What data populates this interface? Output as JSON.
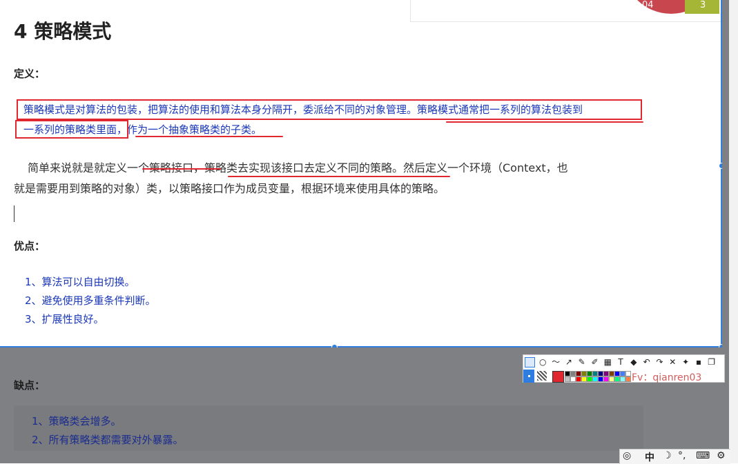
{
  "doc": {
    "chart_remnant": {
      "label_04": "04",
      "label_3": "3"
    },
    "title": "4 策略模式",
    "definition": {
      "label": "定义：",
      "line1": "策略模式是对算法的包装，把算法的使用和算法本身分隔开，委派给不同的对象管理。策略模式通常把一系列的算法包装到",
      "line2": "一系列的策略类里面，作为一个抽象策略类的子类。"
    },
    "explanation": {
      "line1": "简单来说就是就定义一个策略接口，策略类去实现该接口去定义不同的策略。然后定义一个环境（Context，也",
      "line2": "就是需要用到策略的对象）类，以策略接口作为成员变量，根据环境来使用具体的策略。"
    },
    "pros": {
      "label": "优点：",
      "items": [
        "1、算法可以自由切换。",
        "2、避免使用多重条件判断。",
        "3、扩展性良好。"
      ]
    },
    "cons": {
      "label": "缺点：",
      "items": [
        "1、策略类会增多。",
        "2、所有策略类都需要对外暴露。"
      ]
    }
  },
  "annotation_toolbar": {
    "tools": [
      "rectangle-icon",
      "ellipse-icon",
      "freehand-icon",
      "arrow-icon",
      "pen-icon",
      "highlighter-icon",
      "mosaic-icon",
      "text-icon",
      "eraser-icon",
      "undo-icon",
      "redo-icon",
      "cancel-icon",
      "pin-icon",
      "save-icon",
      "copy-icon"
    ],
    "tool_glyphs": [
      "",
      "○",
      "〜",
      "↗",
      "✎",
      "✐",
      "▦",
      "T",
      "◆",
      "↶",
      "↷",
      "✕",
      "✦",
      "▪",
      "❐"
    ],
    "current_color": "#e0262f",
    "palette_top": [
      "#000000",
      "#808080",
      "#800000",
      "#808000",
      "#008000",
      "#008080",
      "#000080",
      "#800080",
      "#804000",
      "#0000ff",
      "#4080ff",
      "#ffffff"
    ],
    "palette_bottom": [
      "#c0c0c0",
      "#ffffff",
      "#ff0000",
      "#ffff00",
      "#00ff00",
      "#00ffff",
      "#0000ff",
      "#ff00ff",
      "#ffff80",
      "#00ff80",
      "#80ffff",
      "#ff8040"
    ],
    "watermark": "Fv：qianren03"
  },
  "tray": {
    "ime_mode": "中",
    "moon": "☽",
    "punct": "°,",
    "keyboard": "⌨",
    "settings": "⚙"
  }
}
